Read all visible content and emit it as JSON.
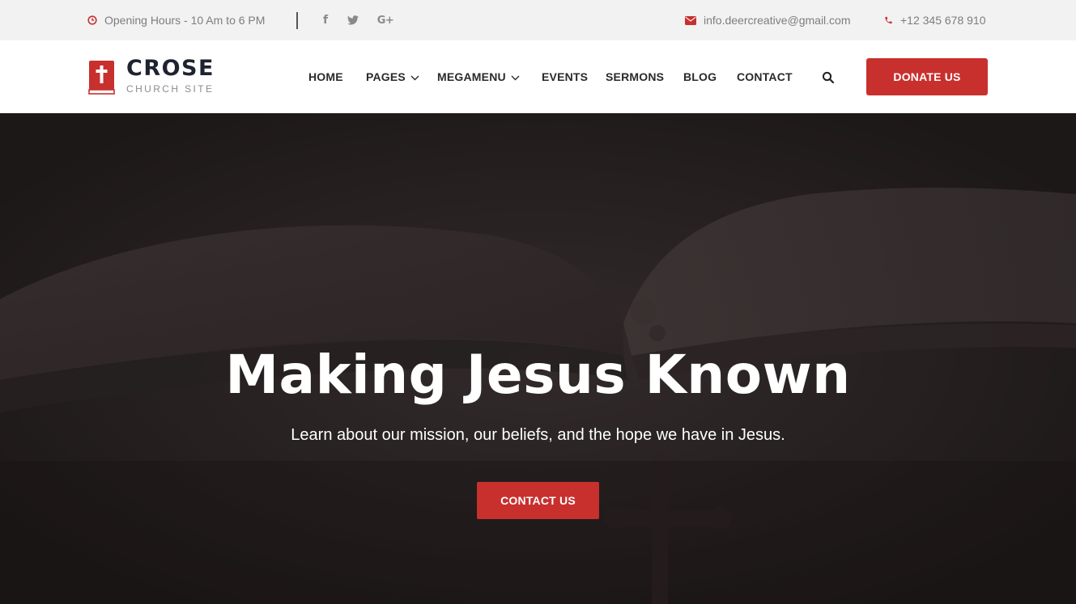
{
  "topbar": {
    "hours": "Opening Hours - 10 Am to 6 PM",
    "hours_icon": "clock-icon",
    "social": [
      {
        "name": "facebook-icon",
        "glyph": "f"
      },
      {
        "name": "twitter-icon",
        "glyph": ""
      },
      {
        "name": "google-plus-icon",
        "glyph": "G+"
      }
    ],
    "email": "info.deercreative@gmail.com",
    "email_icon": "envelope-icon",
    "phone": "+12 345 678 910",
    "phone_icon": "phone-icon"
  },
  "brand": {
    "title": "CROSE",
    "subtitle": "CHURCH SITE",
    "icon": "bible-cross-icon"
  },
  "nav": {
    "items": [
      {
        "label": "HOME",
        "has_dropdown": false
      },
      {
        "label": "PAGES",
        "has_dropdown": true
      },
      {
        "label": "MEGAMENU",
        "has_dropdown": true
      },
      {
        "label": "EVENTS",
        "has_dropdown": false
      },
      {
        "label": "SERMONS",
        "has_dropdown": false
      },
      {
        "label": "BLOG",
        "has_dropdown": false
      },
      {
        "label": "CONTACT",
        "has_dropdown": false
      }
    ],
    "search_icon": "search-icon",
    "donate_label": "DONATE US"
  },
  "hero": {
    "title": "Making Jesus Known",
    "subtitle": "Learn about our mission, our beliefs, and the hope we have in Jesus.",
    "button_label": "CONTACT US"
  },
  "colors": {
    "accent": "#c8302e",
    "topbar_bg": "#f2f2f2",
    "header_bg": "#ffffff",
    "nav_text": "#2a2a2a",
    "hero_overlay": "#1f1a1a"
  }
}
